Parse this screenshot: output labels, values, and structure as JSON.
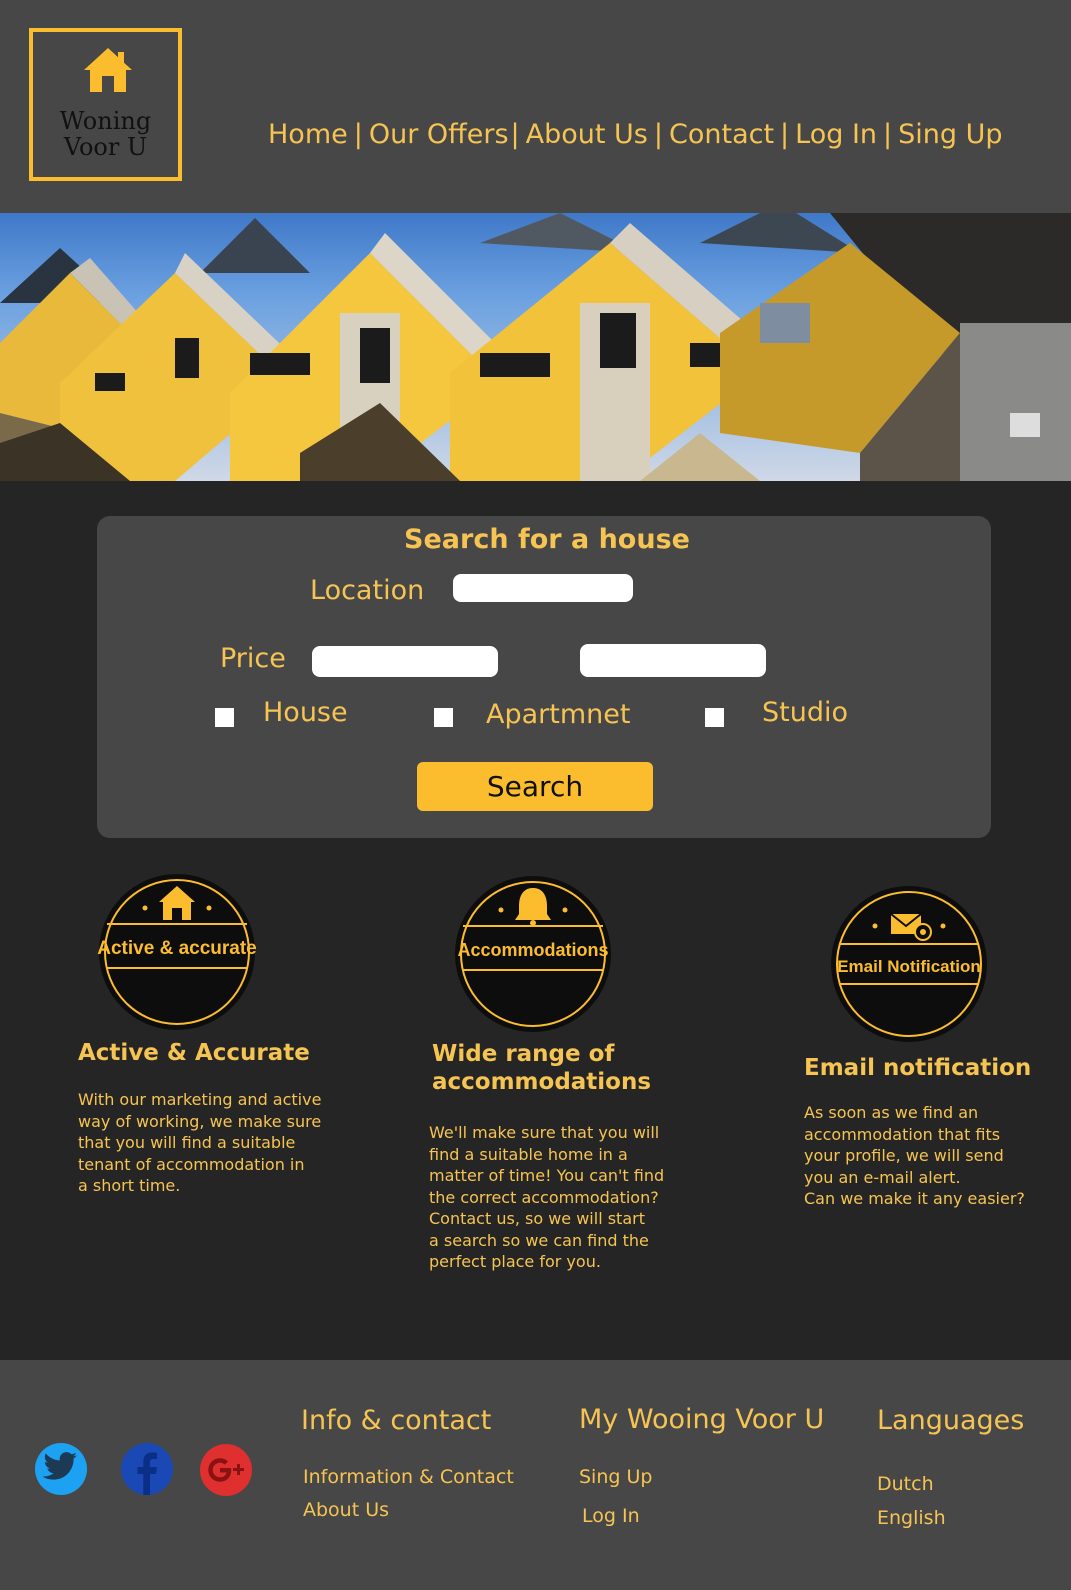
{
  "logo": {
    "line1": "Woning",
    "line2": "Voor U"
  },
  "nav": {
    "items": [
      "Home",
      "Our Offers",
      "About Us",
      "Contact",
      "Log In",
      "Sing Up"
    ],
    "separator": "|"
  },
  "hero": {
    "image": "yellow-cube-houses-photo"
  },
  "search": {
    "title": "Search for a house",
    "location_label": "Location",
    "location_value": "",
    "price_label": "Price",
    "price_min_value": "",
    "price_max_value": "",
    "types": [
      "House",
      "Apartmnet",
      "Studio"
    ],
    "button_label": "Search"
  },
  "features": [
    {
      "badge": "Active & accurate",
      "badge_icon": "house-icon",
      "title": "Active & Accurate",
      "lines": [
        "With our marketing and active",
        "way of working, we make sure",
        "that you will find a suitable",
        "tenant of accommodation in",
        "a short time."
      ]
    },
    {
      "badge": "Accommodations",
      "badge_icon": "bell-icon",
      "title_lines": [
        "Wide range of",
        "accommodations"
      ],
      "lines": [
        "We'll make sure that you will",
        "find a suitable home in a",
        "matter of time! You can't find",
        "the correct accommodation?",
        "Contact us, so we will start",
        "a search so we can find the",
        "perfect place for you."
      ]
    },
    {
      "badge": "Email Notification",
      "badge_icon": "envelope-at-icon",
      "title": "Email notification",
      "lines": [
        "As soon as we find an",
        "accommodation that fits",
        "your profile, we will send",
        "you an e-mail alert.",
        "Can we make it any easier?"
      ]
    }
  ],
  "footer": {
    "social": [
      "twitter-icon",
      "facebook-icon",
      "google-plus-icon"
    ],
    "info": {
      "heading": "Info & contact",
      "links": [
        "Information & Contact",
        "About Us"
      ]
    },
    "account": {
      "heading": "My Wooing Voor U",
      "links": [
        "Sing Up",
        "Log In"
      ]
    },
    "languages": {
      "heading": "Languages",
      "links": [
        "Dutch",
        "English"
      ]
    }
  },
  "colors": {
    "accent": "#fbbd2d",
    "text": "#f6c453",
    "panel": "#474747",
    "background": "#252525",
    "twitter": "#1da1f2",
    "facebook": "#1a49b5",
    "google": "#e02f2f"
  }
}
